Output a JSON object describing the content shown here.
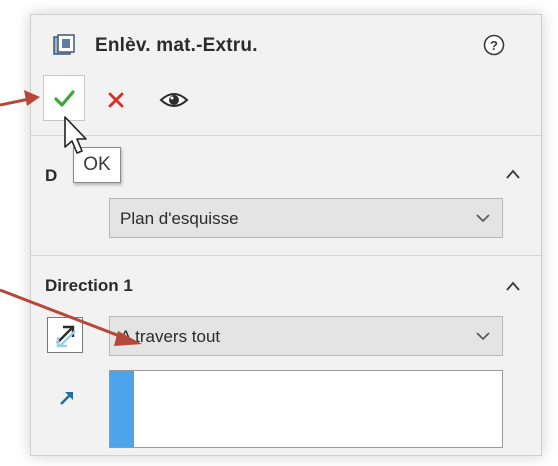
{
  "panel": {
    "title": "Enlèv. mat.-Extru.",
    "icons": {
      "feature": "extrude-cut-icon",
      "help": "help-icon"
    }
  },
  "actions": {
    "ok": "checkmark-icon",
    "cancel": "close-icon",
    "preview": "eye-icon",
    "tooltip": "OK"
  },
  "section_from": {
    "title": "De",
    "title_visible": "D",
    "dropdown_value": "Plan d'esquisse"
  },
  "section_direction1": {
    "title": "Direction 1",
    "end_condition": "A travers tout",
    "reverse_icon": "reverse-direction-icon",
    "direction_icon": "direction-arrow-icon"
  },
  "colors": {
    "ok_green": "#3aa835",
    "cancel_red": "#d93025",
    "accent_blue": "#4da3ec",
    "annotation_red": "#b5483b"
  }
}
